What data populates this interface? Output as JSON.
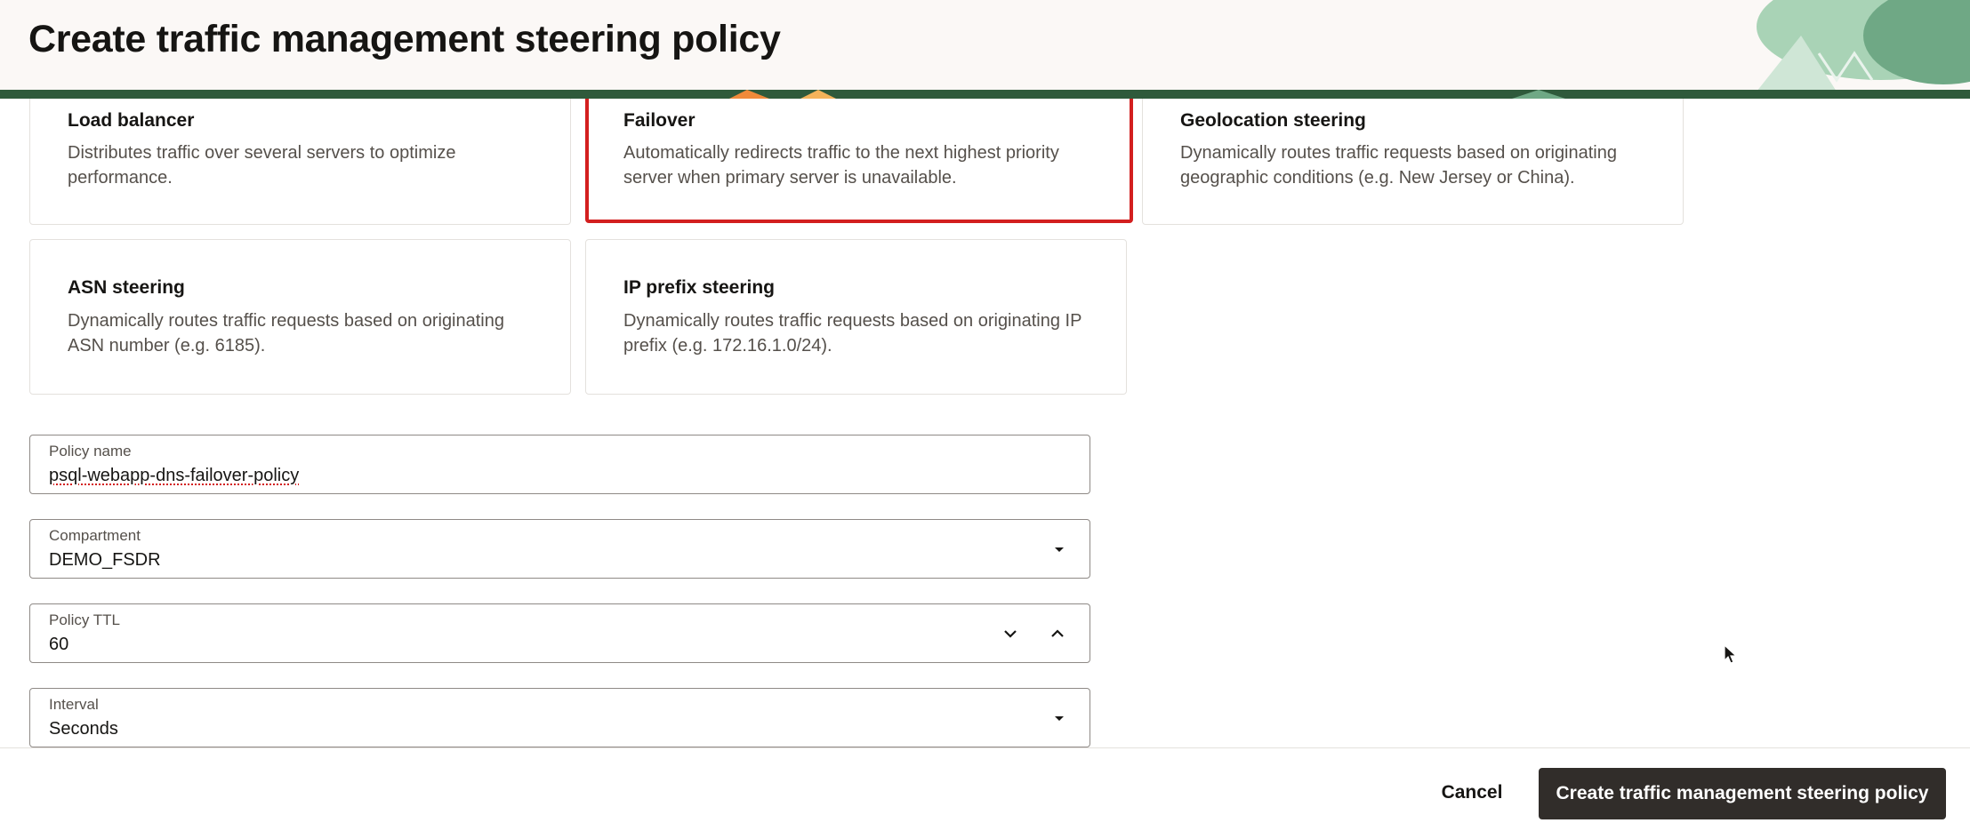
{
  "header": {
    "title": "Create traffic management steering policy"
  },
  "policy_types": [
    {
      "title": "Load balancer",
      "description": "Distributes traffic over several servers to optimize performance.",
      "selected": false
    },
    {
      "title": "Failover",
      "description": "Automatically redirects traffic to the next highest priority server when primary server is unavailable.",
      "selected": true
    },
    {
      "title": "Geolocation steering",
      "description": "Dynamically routes traffic requests based on originating geographic conditions (e.g. New Jersey or China).",
      "selected": false
    },
    {
      "title": "ASN steering",
      "description": "Dynamically routes traffic requests based on originating ASN number (e.g. 6185).",
      "selected": false
    },
    {
      "title": "IP prefix steering",
      "description": "Dynamically routes traffic requests based on originating IP prefix (e.g. 172.16.1.0/24).",
      "selected": false
    }
  ],
  "form": {
    "policy_name": {
      "label": "Policy name",
      "value": "psql-webapp-dns-failover-policy"
    },
    "compartment": {
      "label": "Compartment",
      "value": "DEMO_FSDR"
    },
    "policy_ttl": {
      "label": "Policy TTL",
      "value": "60"
    },
    "interval": {
      "label": "Interval",
      "value": "Seconds"
    }
  },
  "footer": {
    "cancel_label": "Cancel",
    "submit_label": "Create traffic management steering policy"
  },
  "colors": {
    "primary_button": "#312d2a",
    "selection_highlight": "#d31f1f",
    "header_bg": "#fbf8f6",
    "deco_green": "#2f5a3b"
  },
  "icons": {
    "dropdown": "chevron-down-icon",
    "increment": "chevron-up-icon",
    "pointer": "mouse-cursor-icon"
  }
}
